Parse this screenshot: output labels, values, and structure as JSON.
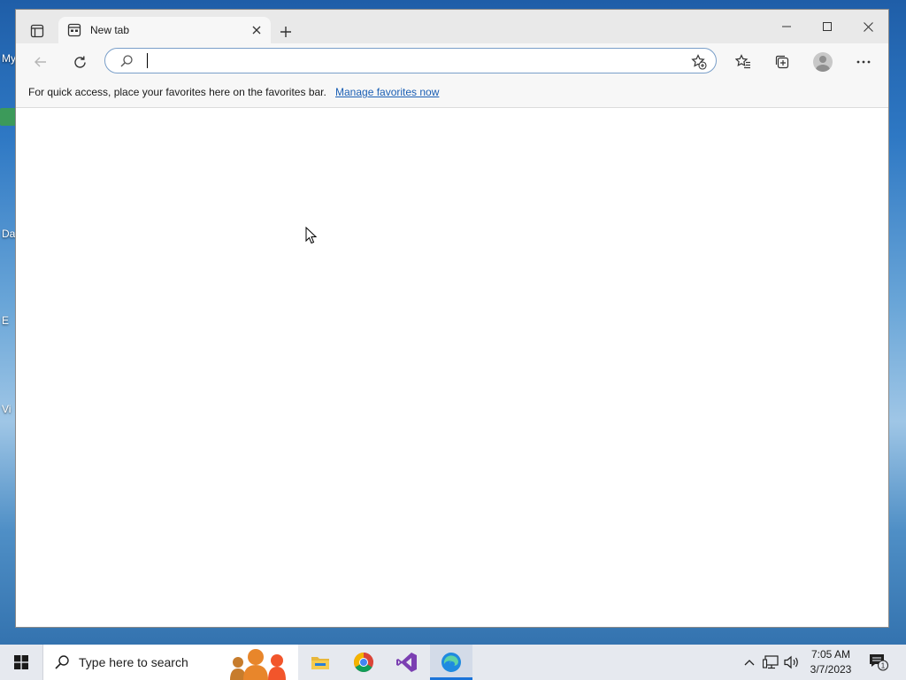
{
  "desktop": {
    "icons": [
      "My",
      "Da",
      "E",
      "Vi"
    ]
  },
  "browser": {
    "tab": {
      "title": "New tab",
      "close_symbol": "✕"
    },
    "new_tab_symbol": "+",
    "window_controls": {
      "minimize": "—",
      "maximize": "☐",
      "close": "✕"
    },
    "address_bar": {
      "value": "",
      "placeholder": ""
    },
    "favorites_bar": {
      "message": "For quick access, place your favorites here on the favorites bar.",
      "link": "Manage favorites now"
    },
    "toolbar_icons": [
      "back-arrow-icon",
      "refresh-icon",
      "favorites-icon",
      "collections-icon",
      "profile-icon",
      "more-icon"
    ]
  },
  "taskbar": {
    "search_placeholder": "Type here to search",
    "apps": [
      "file-explorer",
      "chrome",
      "visual-studio",
      "edge"
    ],
    "active_app": "edge",
    "clock": {
      "time": "7:05 AM",
      "date": "3/7/2023"
    },
    "notification_count": "1"
  },
  "colors": {
    "accent": "#1a73d9",
    "link": "#1a5fb4",
    "titlebar": "#e9e9e9",
    "toolbar": "#f7f7f7"
  }
}
